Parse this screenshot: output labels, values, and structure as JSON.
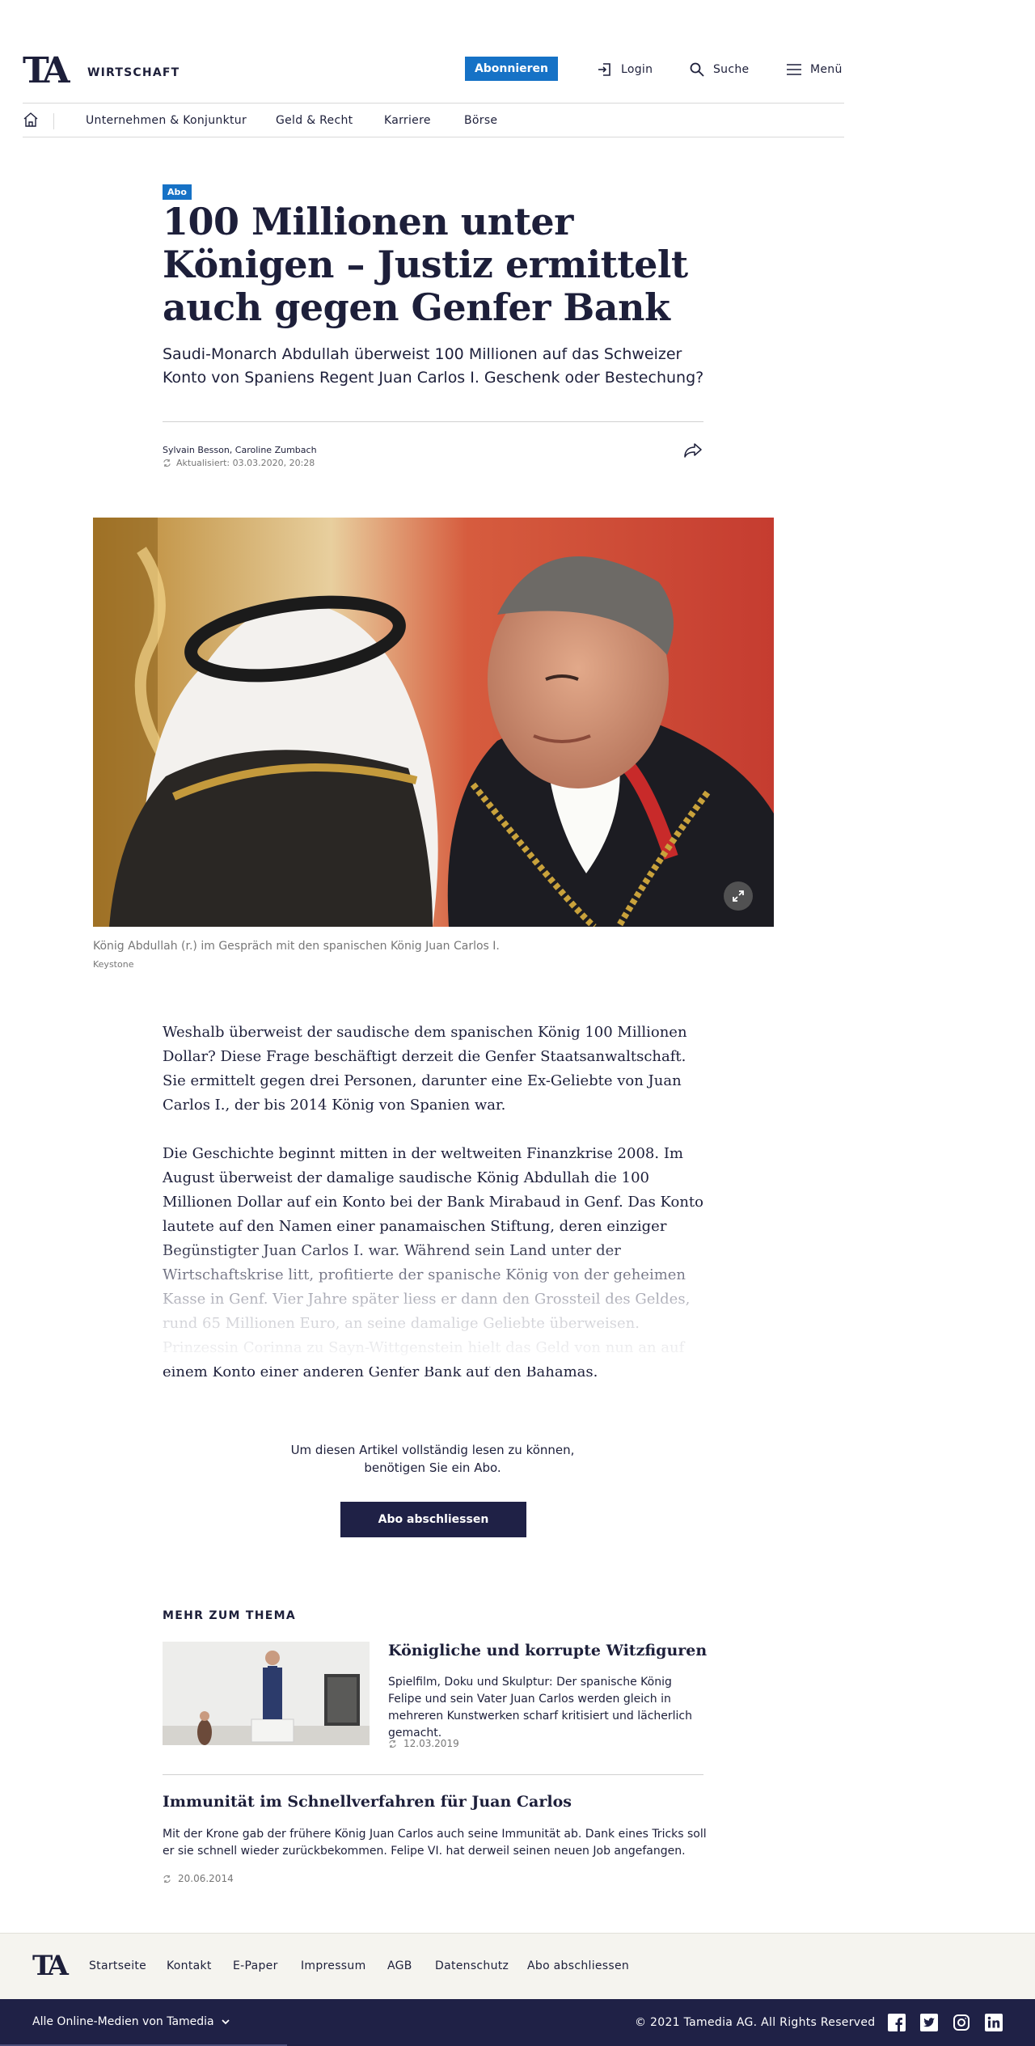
{
  "header": {
    "logo": "TA",
    "section": "WIRTSCHAFT",
    "subscribe_label": "Abonnieren",
    "login_label": "Login",
    "search_label": "Suche",
    "menu_label": "Menü"
  },
  "subnav": {
    "items": [
      "Unternehmen & Konjunktur",
      "Geld & Recht",
      "Karriere",
      "Börse"
    ]
  },
  "article": {
    "badge": "Abo",
    "headline": "100 Millionen unter Königen – Justiz ermittelt auch gegen Genfer Bank",
    "lead": "Saudi-Monarch Abdullah überweist 100 Millionen auf das Schweizer Konto von Spaniens Regent Juan Carlos I. Geschenk oder Bestechung?",
    "authors": "Sylvain Besson, Caroline Zumbach",
    "updated": "Aktualisiert: 03.03.2020, 20:28",
    "image_caption": "König Abdullah (r.) im Gespräch mit den spanischen König Juan Carlos I.",
    "image_credit": "Keystone",
    "paragraphs": [
      "Weshalb überweist der saudische dem spanischen König 100 Millionen Dollar? Diese Frage beschäftigt derzeit die Genfer Staatsanwaltschaft. Sie ermittelt gegen drei Personen, darunter eine Ex-Geliebte von Juan Carlos I., der bis 2014 König von Spanien war.",
      "Die Geschichte beginnt mitten in der weltweiten Finanzkrise 2008. Im August überweist der damalige saudische König Abdullah die 100 Millionen Dollar auf ein Konto bei der Bank Mirabaud in Genf. Das Konto lautete auf den Namen einer panamaischen Stiftung, deren einziger Begünstigter Juan Carlos I. war. Während sein Land unter der Wirtschaftskrise litt, profitierte der spanische König von der geheimen Kasse in Genf. Vier Jahre später liess er dann den Grossteil des Geldes, rund 65 Millionen Euro, an seine damalige Geliebte überweisen. Prinzessin Corinna zu Sayn-Wittgenstein hielt das Geld von nun an auf einem Konto einer anderen Genfer Bank auf den Bahamas."
    ]
  },
  "paywall": {
    "text": "Um diesen Artikel vollständig lesen zu können, benötigen Sie ein Abo.",
    "button_label": "Abo abschliessen"
  },
  "related": {
    "heading": "MEHR ZUM THEMA",
    "items": [
      {
        "title": "Königliche und korrupte Witzfiguren",
        "teaser": "Spielfilm, Doku und Skulptur: Der spanische König Felipe und sein Vater Juan Carlos werden gleich in mehreren Kunstwerken scharf kritisiert und lächerlich gemacht.",
        "date": "12.03.2019"
      },
      {
        "title": "Immunität im Schnellverfahren für Juan Carlos",
        "teaser": "Mit der Krone gab der frühere König Juan Carlos auch seine Immunität ab. Dank eines Tricks soll er sie schnell wieder zurückbekommen. Felipe VI. hat derweil seinen neuen Job angefangen.",
        "date": "20.06.2014"
      }
    ]
  },
  "footer": {
    "logo": "TA",
    "links": [
      "Startseite",
      "Kontakt",
      "E-Paper",
      "Impressum",
      "AGB",
      "Datenschutz",
      "Abo abschliessen"
    ],
    "media_select": "Alle Online-Medien von Tamedia",
    "copyright": "© 2021 Tamedia AG. All Rights Reserved",
    "social_icons": [
      "facebook-icon",
      "twitter-icon",
      "instagram-icon",
      "linkedin-icon"
    ]
  },
  "colors": {
    "brand_navy": "#1f2146",
    "accent_blue": "#1672c6",
    "text": "#1d1f3a",
    "muted": "#777777",
    "footer_bg": "#f5f4ef"
  }
}
